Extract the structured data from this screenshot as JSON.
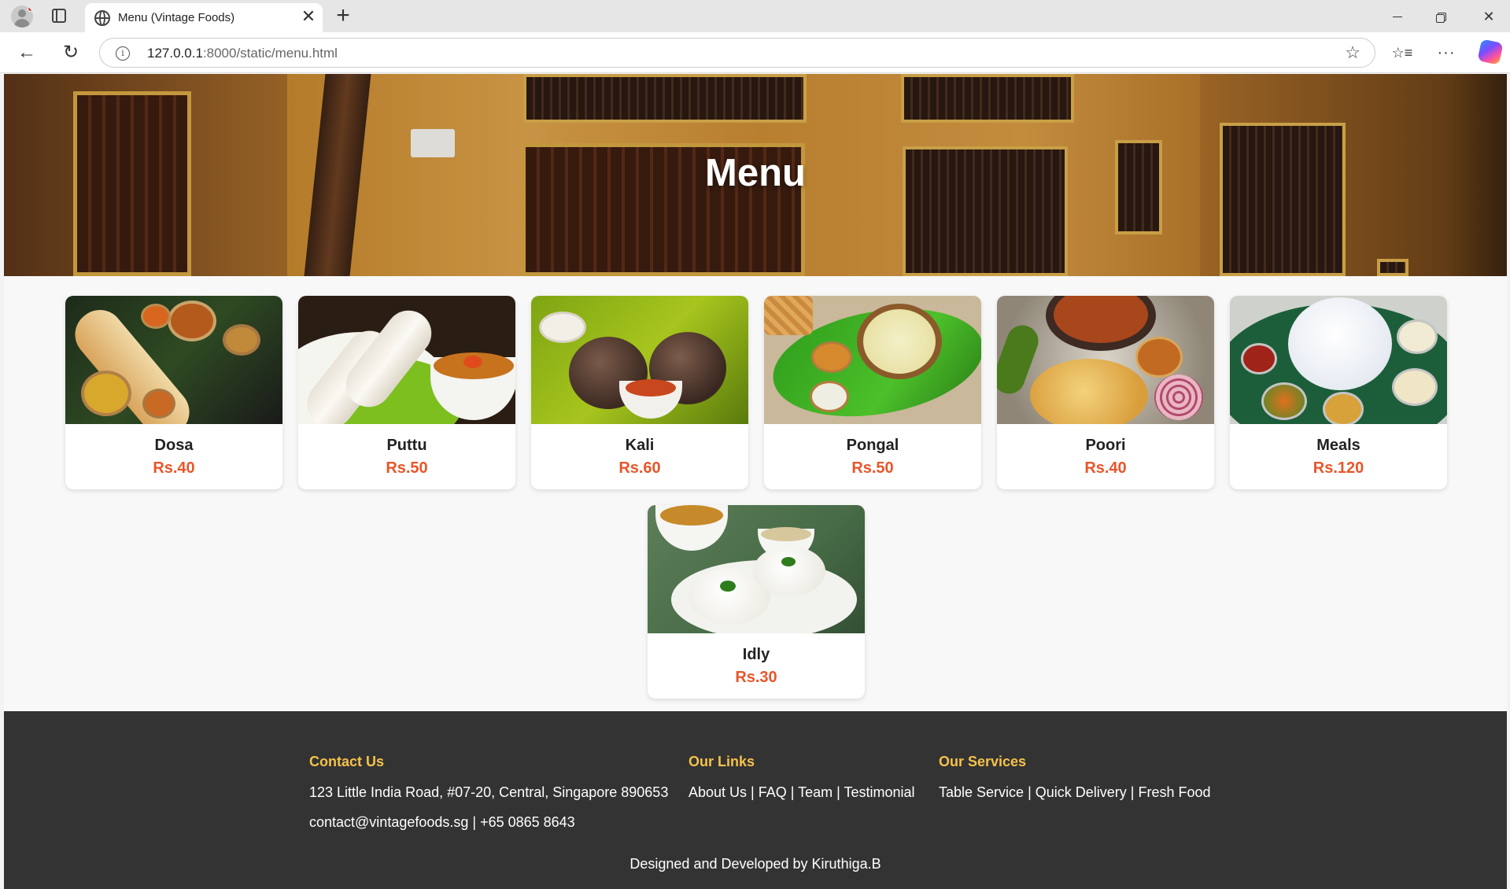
{
  "browser": {
    "tab_title": "Menu (Vintage Foods)",
    "url_host": "127.0.0.1",
    "url_rest": ":8000/static/menu.html",
    "close_glyph": "✕",
    "newtab_glyph": "+",
    "back_glyph": "←",
    "reload_glyph": "↻",
    "star_glyph": "☆",
    "favorites_glyph": "☆≡",
    "more_glyph": "···",
    "win_close_glyph": "✕"
  },
  "hero": {
    "title": "Menu"
  },
  "menu": {
    "items": [
      {
        "name": "Dosa",
        "price": "Rs.40"
      },
      {
        "name": "Puttu",
        "price": "Rs.50"
      },
      {
        "name": "Kali",
        "price": "Rs.60"
      },
      {
        "name": "Pongal",
        "price": "Rs.50"
      },
      {
        "name": "Poori",
        "price": "Rs.40"
      },
      {
        "name": "Meals",
        "price": "Rs.120"
      },
      {
        "name": "Idly",
        "price": "Rs.30"
      }
    ]
  },
  "footer": {
    "contact_heading": "Contact Us",
    "address": "123 Little India Road, #07-20, Central, Singapore 890653",
    "contact_line": "contact@vintagefoods.sg | +65 0865 8643",
    "links_heading": "Our Links",
    "links": [
      "About Us",
      "FAQ",
      "Team",
      "Testimonial"
    ],
    "services_heading": "Our Services",
    "services": [
      "Table Service",
      "Quick Delivery",
      "Fresh Food"
    ],
    "separator": " | ",
    "credit": "Designed and Developed by Kiruthiga.B"
  },
  "colors": {
    "price": "#e8562a",
    "footer_bg": "#333333",
    "footer_heading": "#f5c24a"
  }
}
